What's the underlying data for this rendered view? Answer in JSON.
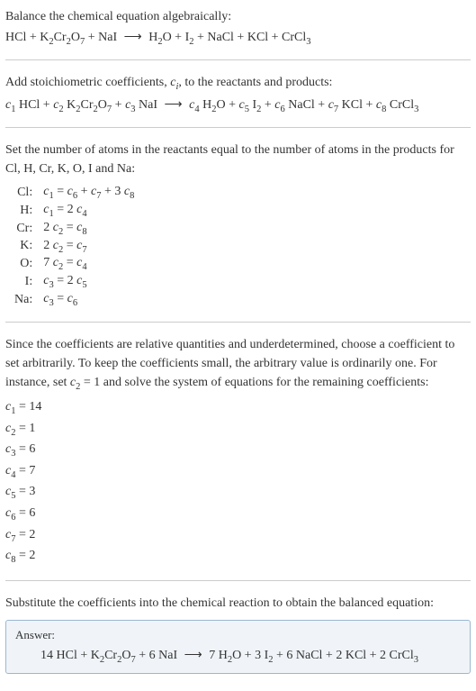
{
  "intro": {
    "line1": "Balance the chemical equation algebraically:",
    "equation": "HCl + K₂Cr₂O₇ + NaI ⟶ H₂O + I₂ + NaCl + KCl + CrCl₃"
  },
  "stoich": {
    "line1_a": "Add stoichiometric coefficients, ",
    "line1_ci": "c",
    "line1_ci_sub": "i",
    "line1_b": ", to the reactants and products:",
    "equation_parts": {
      "c1": "c₁",
      "r1": " HCl + ",
      "c2": "c₂",
      "r2": " K₂Cr₂O₇ + ",
      "c3": "c₃",
      "r3": " NaI ",
      "arrow": "⟶",
      "c4": " c₄",
      "r4": " H₂O + ",
      "c5": "c₅",
      "r5": " I₂ + ",
      "c6": "c₆",
      "r6": " NaCl + ",
      "c7": "c₇",
      "r7": " KCl + ",
      "c8": "c₈",
      "r8": " CrCl₃"
    }
  },
  "atoms_intro": {
    "line1": "Set the number of atoms in the reactants equal to the number of atoms in the products for Cl, H, Cr, K, O, I and Na:"
  },
  "atoms_table": [
    {
      "el": "Cl:",
      "eq": "c₁ = c₆ + c₇ + 3 c₈"
    },
    {
      "el": "H:",
      "eq": "c₁ = 2 c₄"
    },
    {
      "el": "Cr:",
      "eq": "2 c₂ = c₈"
    },
    {
      "el": "K:",
      "eq": "2 c₂ = c₇"
    },
    {
      "el": "O:",
      "eq": "7 c₂ = c₄"
    },
    {
      "el": "I:",
      "eq": "c₃ = 2 c₅"
    },
    {
      "el": "Na:",
      "eq": "c₃ = c₆"
    }
  ],
  "solve_intro": {
    "text": "Since the coefficients are relative quantities and underdetermined, choose a coefficient to set arbitrarily. To keep the coefficients small, the arbitrary value is ordinarily one. For instance, set c₂ = 1 and solve the system of equations for the remaining coefficients:"
  },
  "coeffs": [
    "c₁ = 14",
    "c₂ = 1",
    "c₃ = 6",
    "c₄ = 7",
    "c₅ = 3",
    "c₆ = 6",
    "c₇ = 2",
    "c₈ = 2"
  ],
  "substitute": {
    "text": "Substitute the coefficients into the chemical reaction to obtain the balanced equation:"
  },
  "answer": {
    "label": "Answer:",
    "equation": "14 HCl + K₂Cr₂O₇ + 6 NaI ⟶ 7 H₂O + 3 I₂ + 6 NaCl + 2 KCl + 2 CrCl₃"
  },
  "chart_data": {
    "type": "table",
    "title": "Chemical equation balancing (algebraic)",
    "reactants": [
      "HCl",
      "K2Cr2O7",
      "NaI"
    ],
    "products": [
      "H2O",
      "I2",
      "NaCl",
      "KCl",
      "CrCl3"
    ],
    "element_balance_equations": {
      "Cl": "c1 = c6 + c7 + 3*c8",
      "H": "c1 = 2*c4",
      "Cr": "2*c2 = c8",
      "K": "2*c2 = c7",
      "O": "7*c2 = c4",
      "I": "c3 = 2*c5",
      "Na": "c3 = c6"
    },
    "fixed": {
      "c2": 1
    },
    "solution": {
      "c1": 14,
      "c2": 1,
      "c3": 6,
      "c4": 7,
      "c5": 3,
      "c6": 6,
      "c7": 2,
      "c8": 2
    },
    "balanced_equation": "14 HCl + K2Cr2O7 + 6 NaI -> 7 H2O + 3 I2 + 6 NaCl + 2 KCl + 2 CrCl3"
  }
}
